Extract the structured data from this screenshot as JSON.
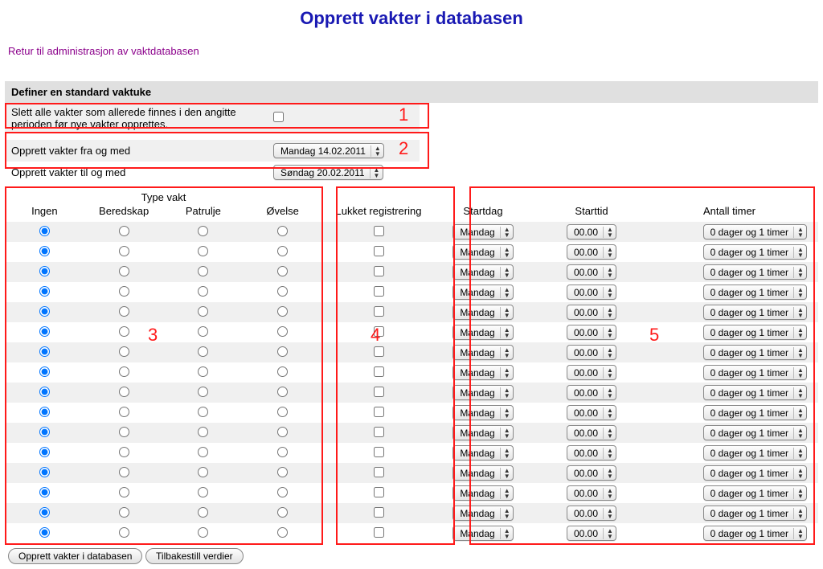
{
  "title": "Opprett vakter i databasen",
  "return_link": "Retur til administrasjon av vaktdatabasen",
  "section_header": "Definer en standard vaktuke",
  "delete_existing": {
    "label": "Slett alle vakter som allerede finnes i den angitte perioden før nye vakter opprettes.",
    "checked": false
  },
  "date_from": {
    "label": "Opprett vakter fra og med",
    "value": "Mandag 14.02.2011"
  },
  "date_to": {
    "label": "Opprett vakter til og med",
    "value": "Søndag 20.02.2011"
  },
  "headers": {
    "type_title": "Type vakt",
    "type_cols": {
      "none": "Ingen",
      "bered": "Beredskap",
      "patr": "Patrulje",
      "ov": "Øvelse"
    },
    "closed": "Lukket registrering",
    "startday": "Startdag",
    "starttime": "Starttid",
    "hours": "Antall timer"
  },
  "row_defaults": {
    "startday": "Mandag",
    "starttime": "00.00",
    "hours": "0 dager og 1 timer"
  },
  "row_count": 16,
  "buttons": {
    "submit": "Opprett vakter i databasen",
    "reset": "Tilbakestill verdier"
  },
  "annotations": {
    "1": "1",
    "2": "2",
    "3": "3",
    "4": "4",
    "5": "5"
  }
}
